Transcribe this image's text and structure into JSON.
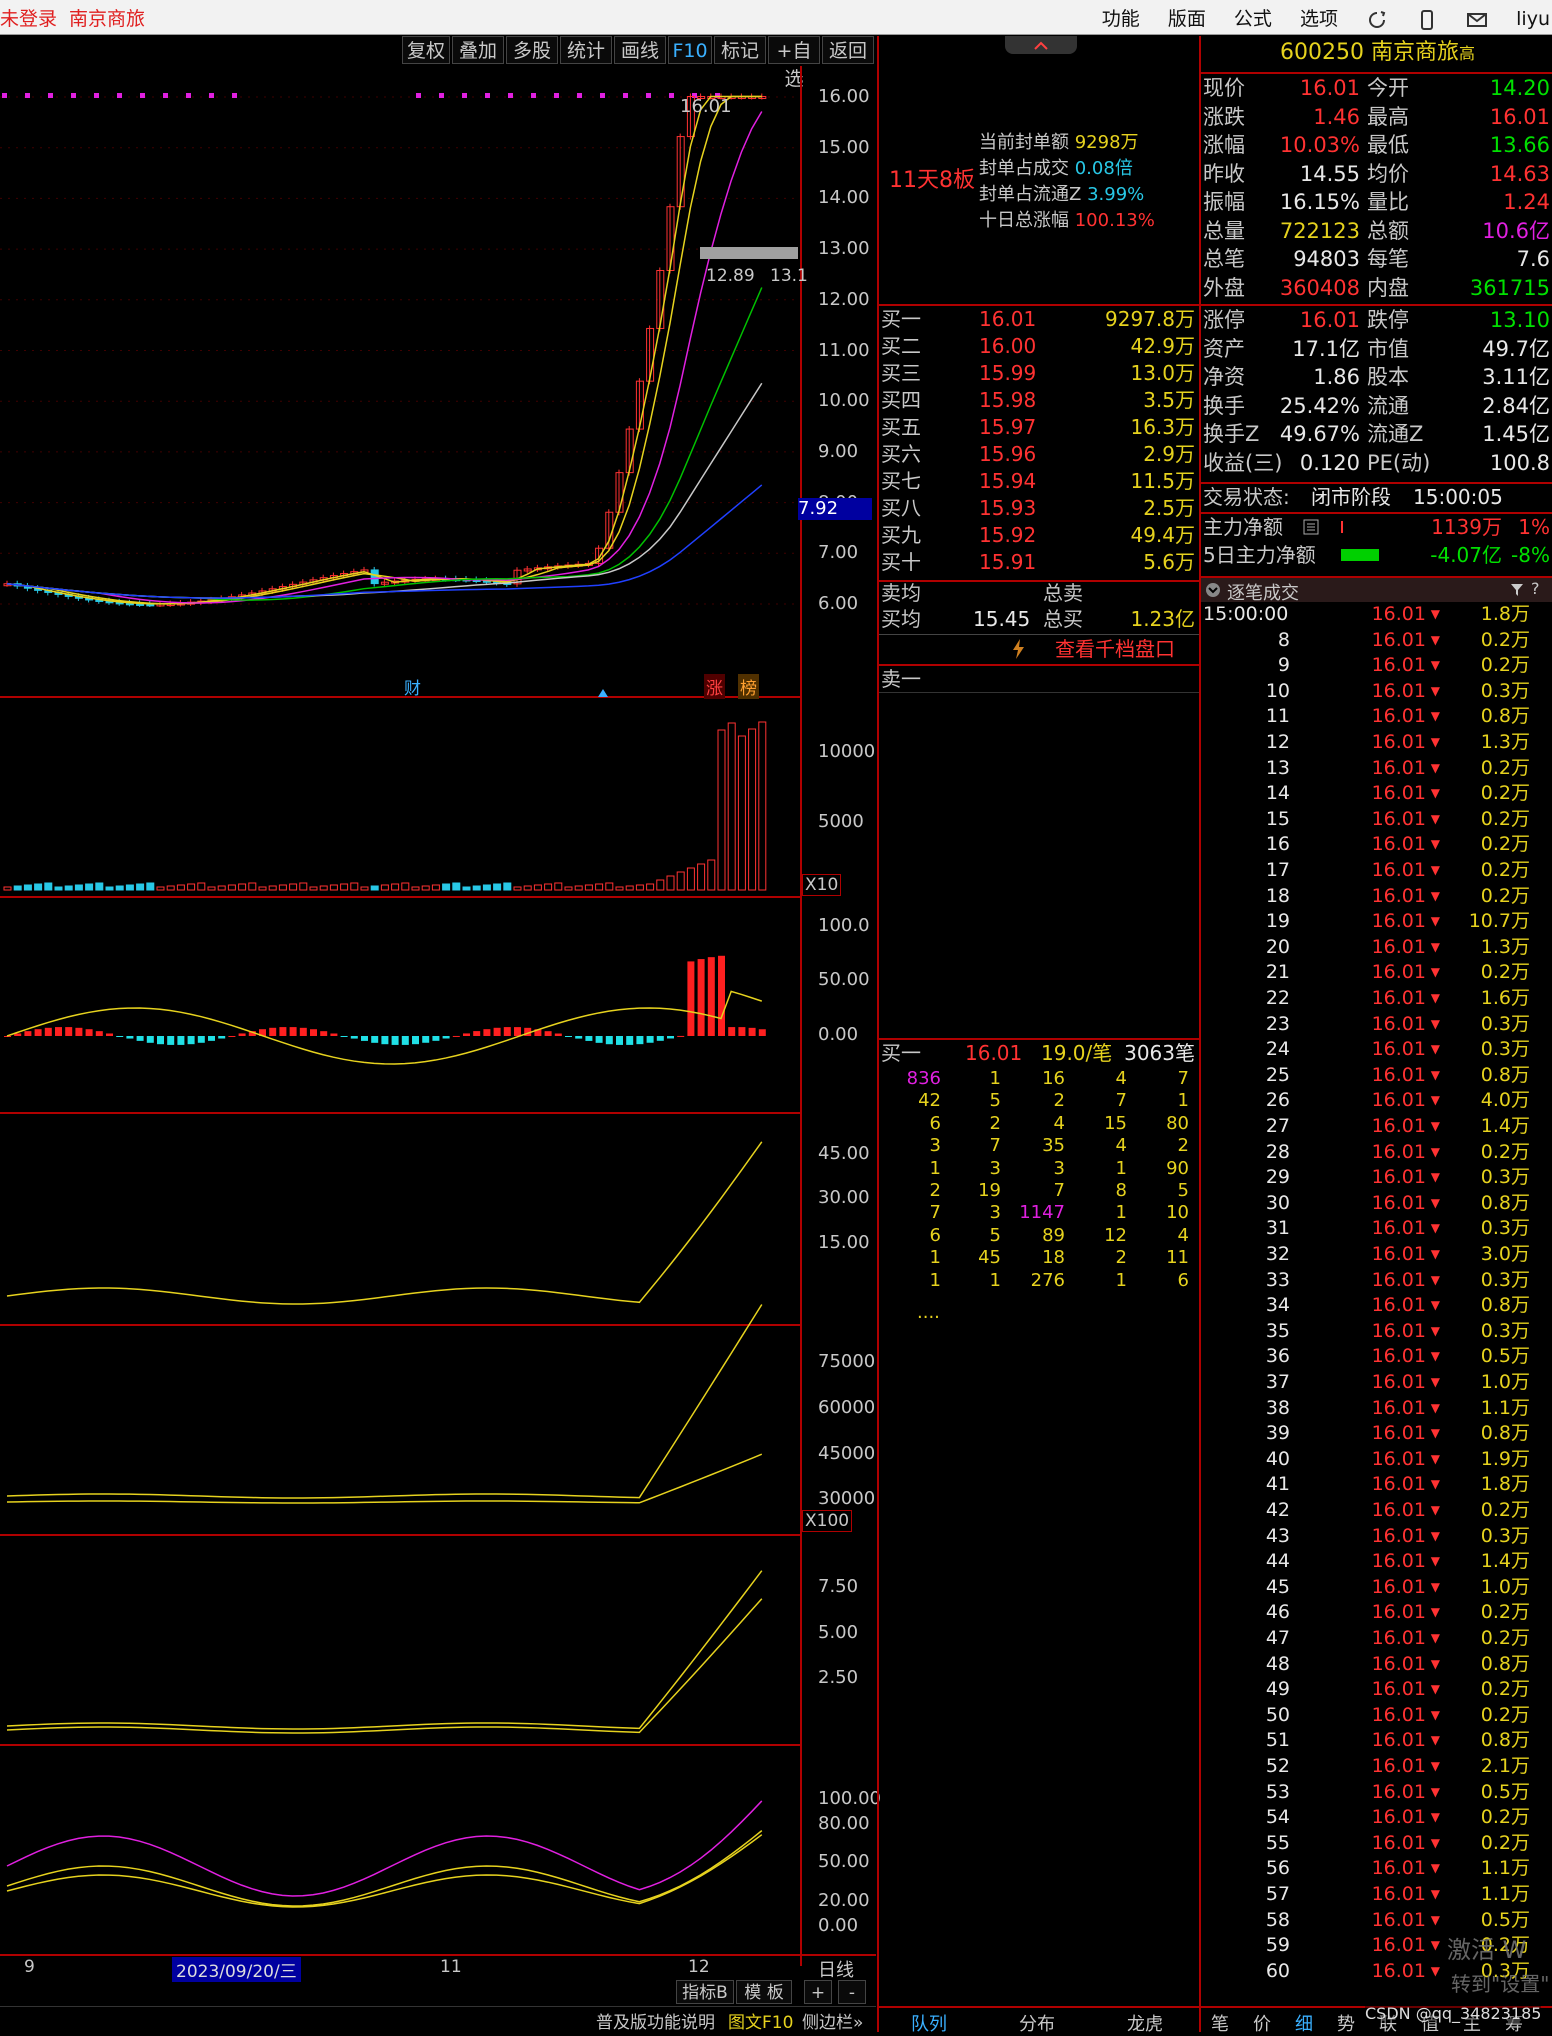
{
  "topbar": {
    "status": "未登录",
    "stock_name": "南京商旅",
    "menu": [
      "功能",
      "版面",
      "公式",
      "选项"
    ],
    "user": "liyu"
  },
  "toolbar": {
    "buttons": [
      "复权",
      "叠加",
      "多股",
      "统计",
      "画线",
      "F10",
      "标记",
      "+自选",
      "返回"
    ]
  },
  "chart_panes": {
    "price": {
      "ticks": [
        "16.00",
        "15.00",
        "14.00",
        "13.00",
        "12.00",
        "11.00",
        "10.00",
        "9.00",
        "8.00",
        "7.00",
        "6.00"
      ],
      "tick_values": [
        16,
        15,
        14,
        13,
        12,
        11,
        10,
        9,
        8,
        7,
        6
      ],
      "current_price_label": "7.92",
      "high_label": "16.01",
      "low_label": "12.89",
      "low_label_2": "13.1",
      "markers": [
        "财",
        "涨",
        "榜"
      ],
      "info": {
        "board_label": "11天8板",
        "seal_amount_label": "当前封单额",
        "seal_amount": "9298万",
        "seal_ratio_label": "封单占成交",
        "seal_ratio": "0.08倍",
        "seal_float_label": "封单占流通Z",
        "seal_float": "3.99%",
        "ten_day_label": "十日总涨幅",
        "ten_day": "100.13%"
      }
    },
    "volume": {
      "ticks": [
        "10000",
        "5000"
      ],
      "unit": "X10"
    },
    "macd": {
      "ticks": [
        "100.0",
        "50.00",
        "0.00"
      ]
    },
    "pane4": {
      "ticks": [
        "45.00",
        "30.00",
        "15.00"
      ]
    },
    "pane5": {
      "ticks": [
        "75000",
        "60000",
        "45000",
        "30000"
      ],
      "unit": "X100"
    },
    "pane6": {
      "ticks": [
        "7.50",
        "5.00",
        "2.50"
      ]
    },
    "kdj": {
      "ticks": [
        "100.00",
        "80.00",
        "50.00",
        "20.00",
        "0.00"
      ]
    },
    "date_axis": {
      "labels": [
        "9",
        "2023/09/20/三",
        "11",
        "12"
      ],
      "period": "日线"
    },
    "bottom_buttons": [
      "指标B",
      "模 板",
      "+",
      "-"
    ],
    "bottom_links": [
      "普及版功能说明",
      "图文F10",
      "侧边栏»"
    ]
  },
  "orderbook": {
    "bids": [
      {
        "label": "买一",
        "price": "16.01",
        "volume": "9297.8万"
      },
      {
        "label": "买二",
        "price": "16.00",
        "volume": "42.9万"
      },
      {
        "label": "买三",
        "price": "15.99",
        "volume": "13.0万"
      },
      {
        "label": "买四",
        "price": "15.98",
        "volume": "3.5万"
      },
      {
        "label": "买五",
        "price": "15.97",
        "volume": "16.3万"
      },
      {
        "label": "买六",
        "price": "15.96",
        "volume": "2.9万"
      },
      {
        "label": "买七",
        "price": "15.94",
        "volume": "11.5万"
      },
      {
        "label": "买八",
        "price": "15.93",
        "volume": "2.5万"
      },
      {
        "label": "买九",
        "price": "15.92",
        "volume": "49.4万"
      },
      {
        "label": "买十",
        "price": "15.91",
        "volume": "5.6万"
      }
    ],
    "sell_avg_label": "卖均",
    "sell_total_label": "总卖",
    "buy_avg_label": "买均",
    "buy_avg": "15.45",
    "buy_total_label": "总买",
    "buy_total": "1.23亿",
    "view_more": "查看千档盘口",
    "sell_one_label": "卖一",
    "queue": {
      "label": "买一",
      "price": "16.01",
      "avg": "19.0/笔",
      "count": "3063笔",
      "rows": [
        [
          "836",
          "1",
          "16",
          "4",
          "7"
        ],
        [
          "42",
          "5",
          "2",
          "7",
          "1"
        ],
        [
          "6",
          "2",
          "4",
          "15",
          "80"
        ],
        [
          "3",
          "7",
          "35",
          "4",
          "2"
        ],
        [
          "1",
          "3",
          "3",
          "1",
          "90"
        ],
        [
          "2",
          "19",
          "7",
          "8",
          "5"
        ],
        [
          "7",
          "3",
          "1147",
          "1",
          "10"
        ],
        [
          "6",
          "5",
          "89",
          "12",
          "4"
        ],
        [
          "1",
          "45",
          "18",
          "2",
          "11"
        ],
        [
          "1",
          "1",
          "276",
          "1",
          "6"
        ]
      ],
      "more": "...."
    },
    "tabs": [
      "队列",
      "分布",
      "龙虎"
    ]
  },
  "quote": {
    "code": "600250",
    "name": "南京商旅",
    "badge": "高",
    "rows": [
      [
        "现价",
        "16.01",
        "今开",
        "14.20"
      ],
      [
        "涨跌",
        "1.46",
        "最高",
        "16.01"
      ],
      [
        "涨幅",
        "10.03%",
        "最低",
        "13.66"
      ],
      [
        "昨收",
        "14.55",
        "均价",
        "14.63"
      ],
      [
        "振幅",
        "16.15%",
        "量比",
        "1.24"
      ],
      [
        "总量",
        "722123",
        "总额",
        "10.6亿"
      ],
      [
        "总笔",
        "94803",
        "每笔",
        "7.6"
      ],
      [
        "外盘",
        "360408",
        "内盘",
        "361715"
      ]
    ],
    "rows2": [
      [
        "涨停",
        "16.01",
        "跌停",
        "13.10"
      ],
      [
        "资产",
        "17.1亿",
        "市值",
        "49.7亿"
      ],
      [
        "净资",
        "1.86",
        "股本",
        "3.11亿"
      ],
      [
        "换手",
        "25.42%",
        "流通",
        "2.84亿"
      ],
      [
        "换手Z",
        "49.67%",
        "流通Z",
        "1.45亿"
      ],
      [
        "收益(三)",
        "0.120",
        "PE(动)",
        "100.8"
      ]
    ],
    "trade_status_label": "交易状态:",
    "trade_status": "闭市阶段",
    "trade_time": "15:00:05",
    "main_flow_label": "主力净额",
    "main_flow": "1139万",
    "main_flow_pct": "1%",
    "main_flow5_label": "5日主力净额",
    "main_flow5": "-4.07亿",
    "main_flow5_pct": "-8%"
  },
  "ticks_panel": {
    "title": "逐笔成交",
    "first_time": "15:00:00",
    "price": "16.01",
    "rows": [
      [
        "15:00:00",
        "1.8万"
      ],
      [
        "8",
        "0.2万"
      ],
      [
        "9",
        "0.2万"
      ],
      [
        "10",
        "0.3万"
      ],
      [
        "11",
        "0.8万"
      ],
      [
        "12",
        "1.3万"
      ],
      [
        "13",
        "0.2万"
      ],
      [
        "14",
        "0.2万"
      ],
      [
        "15",
        "0.2万"
      ],
      [
        "16",
        "0.2万"
      ],
      [
        "17",
        "0.2万"
      ],
      [
        "18",
        "0.2万"
      ],
      [
        "19",
        "10.7万"
      ],
      [
        "20",
        "1.3万"
      ],
      [
        "21",
        "0.2万"
      ],
      [
        "22",
        "1.6万"
      ],
      [
        "23",
        "0.3万"
      ],
      [
        "24",
        "0.3万"
      ],
      [
        "25",
        "0.8万"
      ],
      [
        "26",
        "4.0万"
      ],
      [
        "27",
        "1.4万"
      ],
      [
        "28",
        "0.2万"
      ],
      [
        "29",
        "0.3万"
      ],
      [
        "30",
        "0.8万"
      ],
      [
        "31",
        "0.3万"
      ],
      [
        "32",
        "3.0万"
      ],
      [
        "33",
        "0.3万"
      ],
      [
        "34",
        "0.8万"
      ],
      [
        "35",
        "0.3万"
      ],
      [
        "36",
        "0.5万"
      ],
      [
        "37",
        "1.0万"
      ],
      [
        "38",
        "1.1万"
      ],
      [
        "39",
        "0.8万"
      ],
      [
        "40",
        "1.9万"
      ],
      [
        "41",
        "1.8万"
      ],
      [
        "42",
        "0.2万"
      ],
      [
        "43",
        "0.3万"
      ],
      [
        "44",
        "1.4万"
      ],
      [
        "45",
        "1.0万"
      ],
      [
        "46",
        "0.2万"
      ],
      [
        "47",
        "0.2万"
      ],
      [
        "48",
        "0.8万"
      ],
      [
        "49",
        "0.2万"
      ],
      [
        "50",
        "0.2万"
      ],
      [
        "51",
        "0.8万"
      ],
      [
        "52",
        "2.1万"
      ],
      [
        "53",
        "0.5万"
      ],
      [
        "54",
        "0.2万"
      ],
      [
        "55",
        "0.2万"
      ],
      [
        "56",
        "1.1万"
      ],
      [
        "57",
        "1.1万"
      ],
      [
        "58",
        "0.5万"
      ],
      [
        "59",
        "0.2万"
      ],
      [
        "60",
        "0.3万"
      ]
    ],
    "tabs": [
      "笔",
      "价",
      "细",
      "势",
      "联",
      "值",
      "主",
      "筹"
    ],
    "watermark": "激活 W",
    "watermark2": "转到\"设置\"",
    "csdn": "CSDN @qq_34823185"
  }
}
